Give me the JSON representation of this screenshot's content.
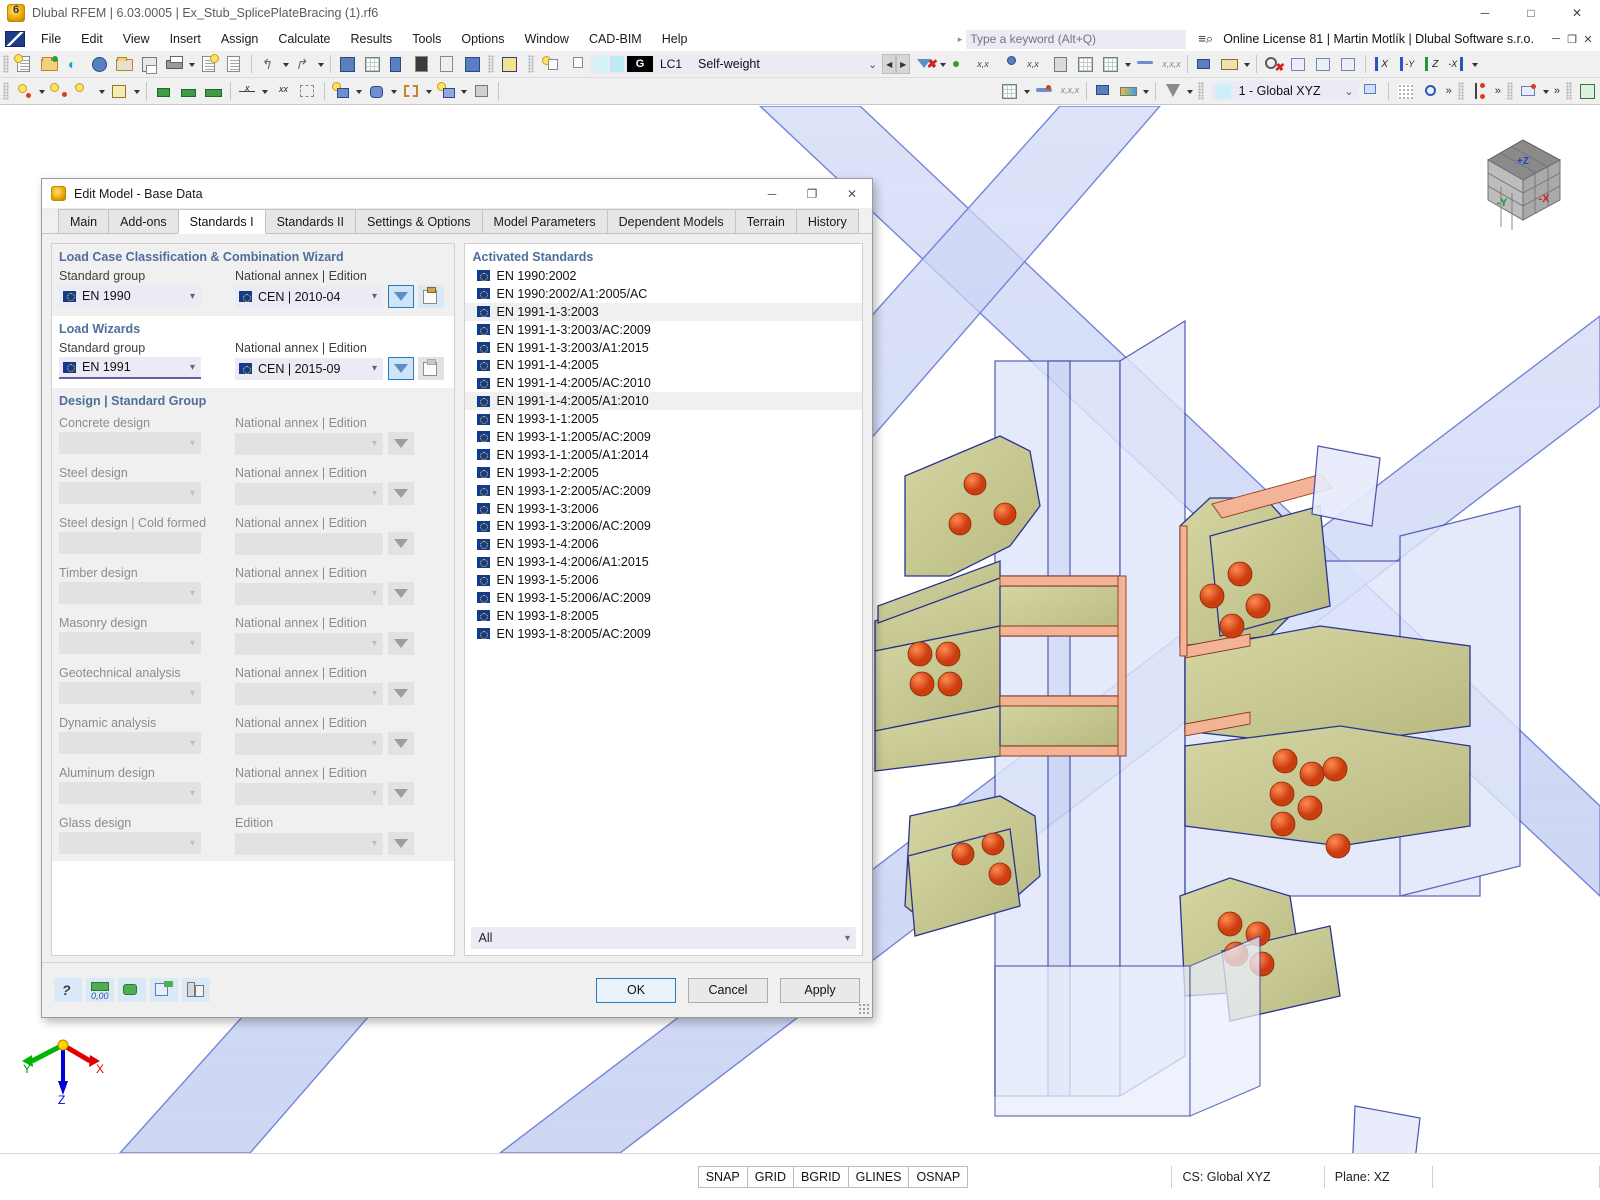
{
  "window": {
    "title": "Dlubal RFEM | 6.03.0005 | Ex_Stub_SplicePlateBracing (1).rf6",
    "minimize": "─",
    "maximize": "□",
    "close": "✕"
  },
  "menu": {
    "items": [
      "File",
      "Edit",
      "View",
      "Insert",
      "Assign",
      "Calculate",
      "Results",
      "Tools",
      "Options",
      "Window",
      "CAD-BIM",
      "Help"
    ],
    "search_placeholder": "Type a keyword (Alt+Q)",
    "license": "Online License 81 | Martin Motlík | Dlubal Software s.r.o.",
    "win_min": "─",
    "win_restore": "❐",
    "win_close": "✕"
  },
  "toolbar": {
    "load_case": {
      "g_label": "G",
      "number": "LC1",
      "name": "Self-weight",
      "chevron": "⌄",
      "prev": "◀",
      "next": "▶"
    },
    "coord_system": {
      "value": "1 - Global XYZ",
      "chevron": "⌄"
    },
    "overflow": "»"
  },
  "viewcube": {
    "top_label": "+Z",
    "left_label": "-Y",
    "right_label": "-X"
  },
  "axes": {
    "x": "X",
    "y": "Y",
    "z": "Z"
  },
  "statusbar": {
    "toggles": [
      "SNAP",
      "GRID",
      "BGRID",
      "GLINES",
      "OSNAP"
    ],
    "cs": "CS: Global XYZ",
    "plane": "Plane: XZ"
  },
  "dialog": {
    "title": "Edit Model - Base Data",
    "minimize": "─",
    "maximize": "❐",
    "close": "✕",
    "tabs": [
      {
        "label": "Main",
        "active": false
      },
      {
        "label": "Add-ons",
        "active": false
      },
      {
        "label": "Standards I",
        "active": true
      },
      {
        "label": "Standards II",
        "active": false
      },
      {
        "label": "Settings & Options",
        "active": false
      },
      {
        "label": "Model Parameters",
        "active": false
      },
      {
        "label": "Dependent Models",
        "active": false
      },
      {
        "label": "Terrain",
        "active": false
      },
      {
        "label": "History",
        "active": false
      }
    ],
    "sections": {
      "wizard": {
        "heading": "Load Case Classification & Combination Wizard",
        "left_label": "Standard group",
        "left_value": "EN 1990",
        "right_label": "National annex | Edition",
        "right_value": "CEN | 2010-04"
      },
      "load_wizards": {
        "heading": "Load Wizards",
        "left_label": "Standard group",
        "left_value": "EN 1991",
        "right_label": "National annex | Edition",
        "right_value": "CEN | 2015-09"
      },
      "design": {
        "heading": "Design | Standard Group",
        "annex_label": "National annex | Edition",
        "edition_label": "Edition",
        "rows": [
          {
            "label": "Concrete design",
            "value": "",
            "annex": "",
            "annex_label": "National annex | Edition",
            "has_chev": true
          },
          {
            "label": "Steel design",
            "value": "",
            "annex": "",
            "annex_label": "National annex | Edition",
            "has_chev": true
          },
          {
            "label": "Steel design | Cold formed",
            "value": "",
            "annex": "",
            "annex_label": "National annex | Edition",
            "has_chev": false
          },
          {
            "label": "Timber design",
            "value": "",
            "annex": "",
            "annex_label": "National annex | Edition",
            "has_chev": true
          },
          {
            "label": "Masonry design",
            "value": "",
            "annex": "",
            "annex_label": "National annex | Edition",
            "has_chev": true
          },
          {
            "label": "Geotechnical analysis",
            "value": "",
            "annex": "",
            "annex_label": "National annex | Edition",
            "has_chev": true
          },
          {
            "label": "Dynamic analysis",
            "value": "",
            "annex": "",
            "annex_label": "National annex | Edition",
            "has_chev": true
          },
          {
            "label": "Aluminum design",
            "value": "",
            "annex": "",
            "annex_label": "National annex | Edition",
            "has_chev": true
          },
          {
            "label": "Glass design",
            "value": "",
            "annex": "",
            "annex_label": "Edition",
            "has_chev": true
          }
        ]
      }
    },
    "standards": {
      "heading": "Activated Standards",
      "items": [
        "EN 1990:2002",
        "EN 1990:2002/A1:2005/AC",
        "EN 1991-1-3:2003",
        "EN 1991-1-3:2003/AC:2009",
        "EN 1991-1-3:2003/A1:2015",
        "EN 1991-1-4:2005",
        "EN 1991-1-4:2005/AC:2010",
        "EN 1991-1-4:2005/A1:2010",
        "EN 1993-1-1:2005",
        "EN 1993-1-1:2005/AC:2009",
        "EN 1993-1-1:2005/A1:2014",
        "EN 1993-1-2:2005",
        "EN 1993-1-2:2005/AC:2009",
        "EN 1993-1-3:2006",
        "EN 1993-1-3:2006/AC:2009",
        "EN 1993-1-4:2006",
        "EN 1993-1-4:2006/A1:2015",
        "EN 1993-1-5:2006",
        "EN 1993-1-5:2006/AC:2009",
        "EN 1993-1-8:2005",
        "EN 1993-1-8:2005/AC:2009"
      ],
      "filter_value": "All",
      "filter_chevron": "⌄"
    },
    "footer": {
      "ok": "OK",
      "cancel": "Cancel",
      "apply": "Apply"
    }
  },
  "colors": {
    "accent": "#2a7ab9",
    "group_heading": "#4f6e9c",
    "combo_bg": "#eceaf5",
    "plate": "#cfcf9a",
    "bolt": "#e04f1e",
    "member": "#8f9fe8"
  }
}
